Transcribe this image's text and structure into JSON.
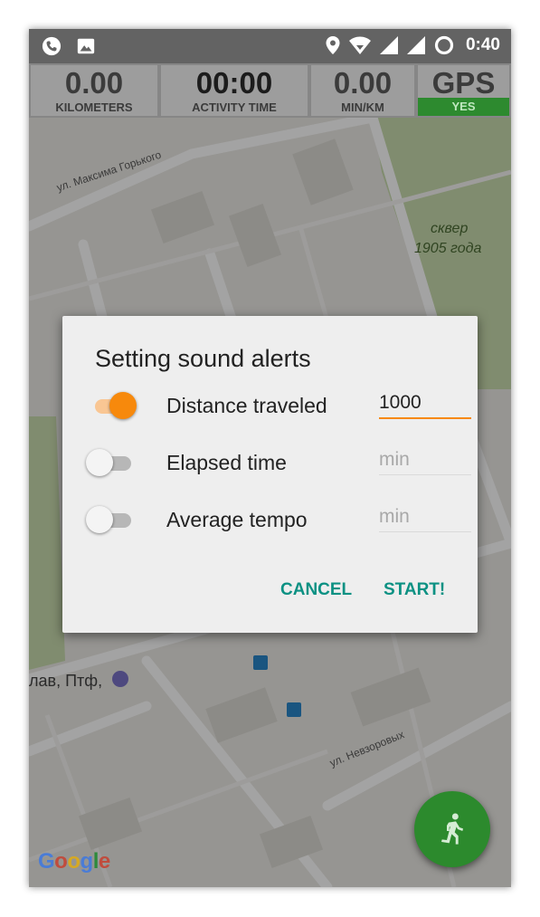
{
  "status_bar": {
    "time": "0:40",
    "left_icons": [
      "phone-icon",
      "image-icon"
    ],
    "right_icons": [
      "location-icon",
      "wifi-icon",
      "signal-icon",
      "signal-icon",
      "sync-icon"
    ]
  },
  "stats": {
    "distance": {
      "value": "0.00",
      "label": "KILOMETERS"
    },
    "activity_time": {
      "value": "00:00",
      "label": "ACTIVITY TIME"
    },
    "pace": {
      "value": "0.00",
      "label": "MIN/KM"
    },
    "gps": {
      "value": "GPS",
      "status": "YES"
    }
  },
  "map": {
    "labels": [
      "ул. Максима Горького",
      "сквер",
      "1905 года",
      "лав, Птф,",
      "ул. Невзоровых"
    ],
    "attribution": "Google"
  },
  "dialog": {
    "title": "Setting sound alerts",
    "rows": [
      {
        "label": "Distance traveled",
        "value": "1000",
        "placeholder": "",
        "enabled": true
      },
      {
        "label": "Elapsed time",
        "value": "",
        "placeholder": "min",
        "enabled": false
      },
      {
        "label": "Average tempo",
        "value": "",
        "placeholder": "min",
        "enabled": false
      }
    ],
    "cancel_label": "CANCEL",
    "start_label": "START!",
    "accent_color": "#f7890c",
    "button_color": "#0c9183"
  },
  "fab": {
    "icon": "running-person-icon",
    "color": "#2c8a2d"
  }
}
